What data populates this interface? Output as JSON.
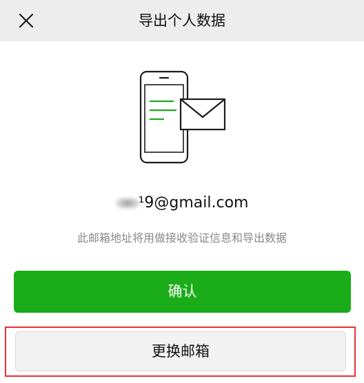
{
  "header": {
    "title": "导出个人数据",
    "close_icon": "close-icon"
  },
  "illustration": {
    "icon": "phone-with-envelope-icon",
    "accent_color": "#1aad19"
  },
  "email": {
    "address_visible": "¹9@gmail.com",
    "hint": "此邮箱地址将用做接收验证信息和导出数据"
  },
  "buttons": {
    "confirm_label": "确认",
    "change_email_label": "更换邮箱"
  },
  "colors": {
    "header_bg": "#ededed",
    "primary": "#1aad19",
    "highlight_border": "#e83030"
  }
}
